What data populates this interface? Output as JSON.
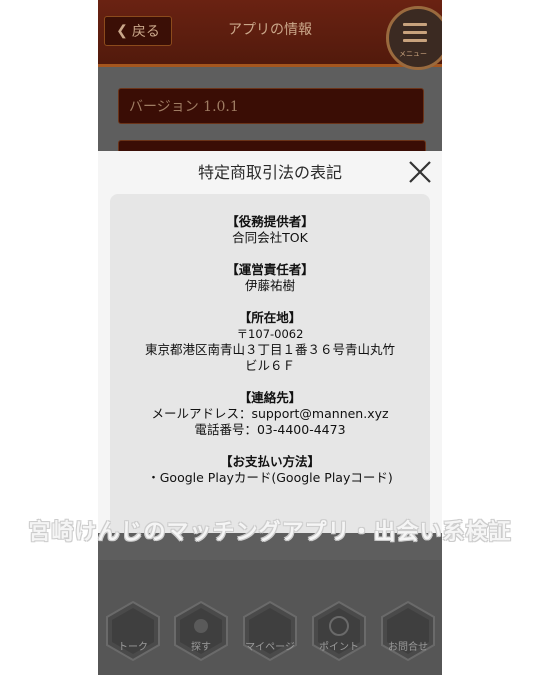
{
  "header": {
    "back_label": "戻る",
    "title": "アプリの情報",
    "menu_label": "メニュー"
  },
  "settings": {
    "version_label": "バージョン 1.0.1"
  },
  "modal": {
    "title": "特定商取引法の表記",
    "provider_head": "【役務提供者】",
    "provider_value": "合同会社TOK",
    "manager_head": "【運営責任者】",
    "manager_value": "伊藤祐樹",
    "address_head": "【所在地】",
    "address_zip": "〒107-0062",
    "address_line1": "東京都港区南青山３丁目１番３６号青山丸竹",
    "address_line2": "ビル６Ｆ",
    "contact_head": "【連絡先】",
    "contact_mail": "メールアドレス：support@mannen.xyz",
    "contact_phone": "電話番号：03-4400-4473",
    "payment_head": "【お支払い方法】",
    "payment_item1": "・Google Playカード(Google Playコード)"
  },
  "bottom_nav": {
    "tabs": [
      {
        "label": "トーク"
      },
      {
        "label": "探す"
      },
      {
        "label": "マイページ"
      },
      {
        "label": "ポイント"
      },
      {
        "label": "お問合せ"
      }
    ]
  },
  "watermark": {
    "text": "宮崎けんじのマッチングアプリ・出会い系検証"
  },
  "colors": {
    "header_bg": "#5a1c0d",
    "accent_border": "#a5561e",
    "modal_bg": "#f5f5f5",
    "panel_bg": "#e6e6e6"
  }
}
